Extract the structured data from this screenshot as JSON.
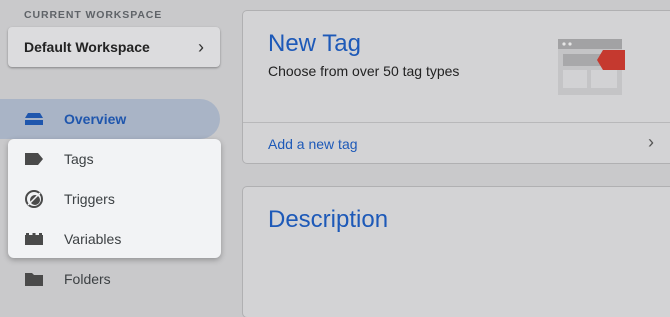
{
  "sidebar": {
    "workspace_label": "CURRENT WORKSPACE",
    "workspace_name": "Default Workspace",
    "items": [
      {
        "label": "Overview",
        "icon": "overview-icon"
      },
      {
        "label": "Tags",
        "icon": "tag-icon"
      },
      {
        "label": "Triggers",
        "icon": "trigger-icon"
      },
      {
        "label": "Variables",
        "icon": "variables-icon"
      },
      {
        "label": "Folders",
        "icon": "folder-icon"
      }
    ]
  },
  "main": {
    "new_tag": {
      "title": "New Tag",
      "subtitle": "Choose from over 50 tag types",
      "link": "Add a new tag"
    },
    "description": {
      "title": "Description"
    }
  },
  "colors": {
    "accent": "#1d59b8",
    "active_nav_bg": "#a9b4c6",
    "tag_red": "#c5392f"
  }
}
